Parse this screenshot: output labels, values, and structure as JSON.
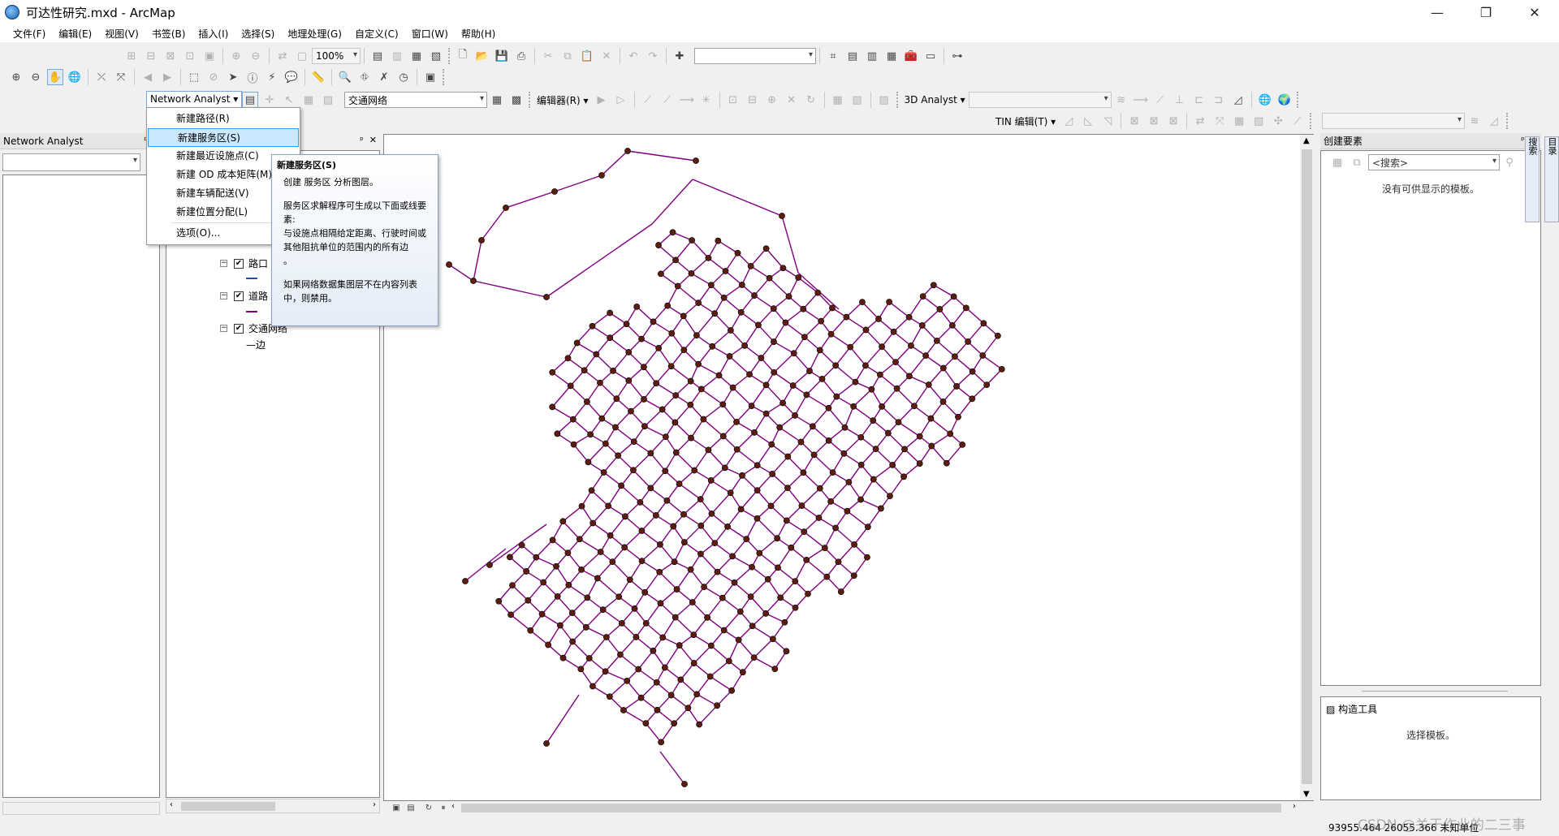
{
  "window": {
    "title": "可达性研究.mxd - ArcMap",
    "minimize": "—",
    "maximize": "❐",
    "close": "✕"
  },
  "menubar": [
    "文件(F)",
    "编辑(E)",
    "视图(V)",
    "书签(B)",
    "插入(I)",
    "选择(S)",
    "地理处理(G)",
    "自定义(C)",
    "窗口(W)",
    "帮助(H)"
  ],
  "toolbar": {
    "zoom_value": "100%",
    "network_analyst_label": "Network Analyst",
    "network_dataset": "交通网络",
    "editor_label": "编辑器(R)",
    "analyst3d_label": "3D Analyst",
    "tin_edit_label": "TIN 编辑(T)"
  },
  "left_panel": {
    "title": "Network Analyst",
    "pin": "ᵖ",
    "close": "✕"
  },
  "na_menu": {
    "items": [
      "新建路径(R)",
      "新建服务区(S)",
      "新建最近设施点(C)",
      "新建 OD 成本矩阵(M)",
      "新建车辆配送(V)",
      "新建位置分配(L)"
    ],
    "options": "选项(O)...",
    "highlighted": "新建服务区(S)"
  },
  "tooltip": {
    "title": "新建服务区(S)",
    "line1": "创建 服务区 分析图层。",
    "line2": "服务区求解程序可生成以下面或线要素:",
    "line3": "与设施点相隔给定距离、行驶时间或其他阻抗单位的范围内的所有边",
    "line4": "。",
    "line5": "如果网络数据集图层不在内容列表中，则禁用。"
  },
  "toc": {
    "layers": [
      {
        "name": "路口",
        "checked": true,
        "legend": "—"
      },
      {
        "name": "道路",
        "checked": true,
        "legend": "—"
      },
      {
        "name": "交通网络",
        "checked": true,
        "legend": "边"
      }
    ],
    "legend_edge": "—边"
  },
  "right_panel": {
    "title": "创建要素",
    "search_placeholder": "<搜索>",
    "empty_msg": "没有可供显示的模板。",
    "construct_title": "构造工具",
    "construct_msg": "选择模板。"
  },
  "right_tabs": [
    "目录",
    "搜索"
  ],
  "status": {
    "coords": "93955.464  26055.366 未知单位"
  },
  "watermark": "CSDN @关于作业的二三事",
  "colors": {
    "road": "#800080",
    "junction": "#5a1e0e",
    "menu_highlight": "#cce8ff"
  }
}
